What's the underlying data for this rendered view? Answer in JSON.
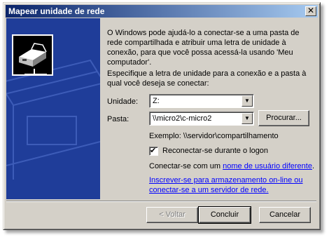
{
  "window": {
    "title": "Mapear unidade de rede",
    "close_glyph": "✕"
  },
  "intro_text": "O Windows pode ajudá-lo a conectar-se a uma pasta de rede compartilhada e atribuir uma letra de unidade à conexão, para que você possa acessá-la usando 'Meu computador'.",
  "instructions_text": "Especifique a letra de unidade para a conexão e a pasta à qual você deseja se conectar:",
  "drive": {
    "label": "Unidade:",
    "value": "Z:"
  },
  "folder": {
    "label": "Pasta:",
    "value": "\\\\micro2\\c-micro2"
  },
  "browse_button": "Procurar...",
  "example_text": "Exemplo: \\\\servidor\\compartilhamento",
  "reconnect": {
    "label": "Reconectar-se durante o logon",
    "checked": true
  },
  "different_user": {
    "prefix": "Conectar-se com um ",
    "link": "nome de usuário diferente",
    "suffix": "."
  },
  "online_storage_link": "Inscrever-se para armazenamento on-line ou conectar-se a um servidor de rede.",
  "footer": {
    "back": "< Voltar",
    "finish": "Concluir",
    "cancel": "Cancelar"
  },
  "icons": {
    "arrow": "▼",
    "check": "✔"
  },
  "colors": {
    "title_start": "#0a246a",
    "title_end": "#a6caf0",
    "panel": "#1f3d99",
    "link": "#0000ff",
    "face": "#d4d0c8"
  }
}
